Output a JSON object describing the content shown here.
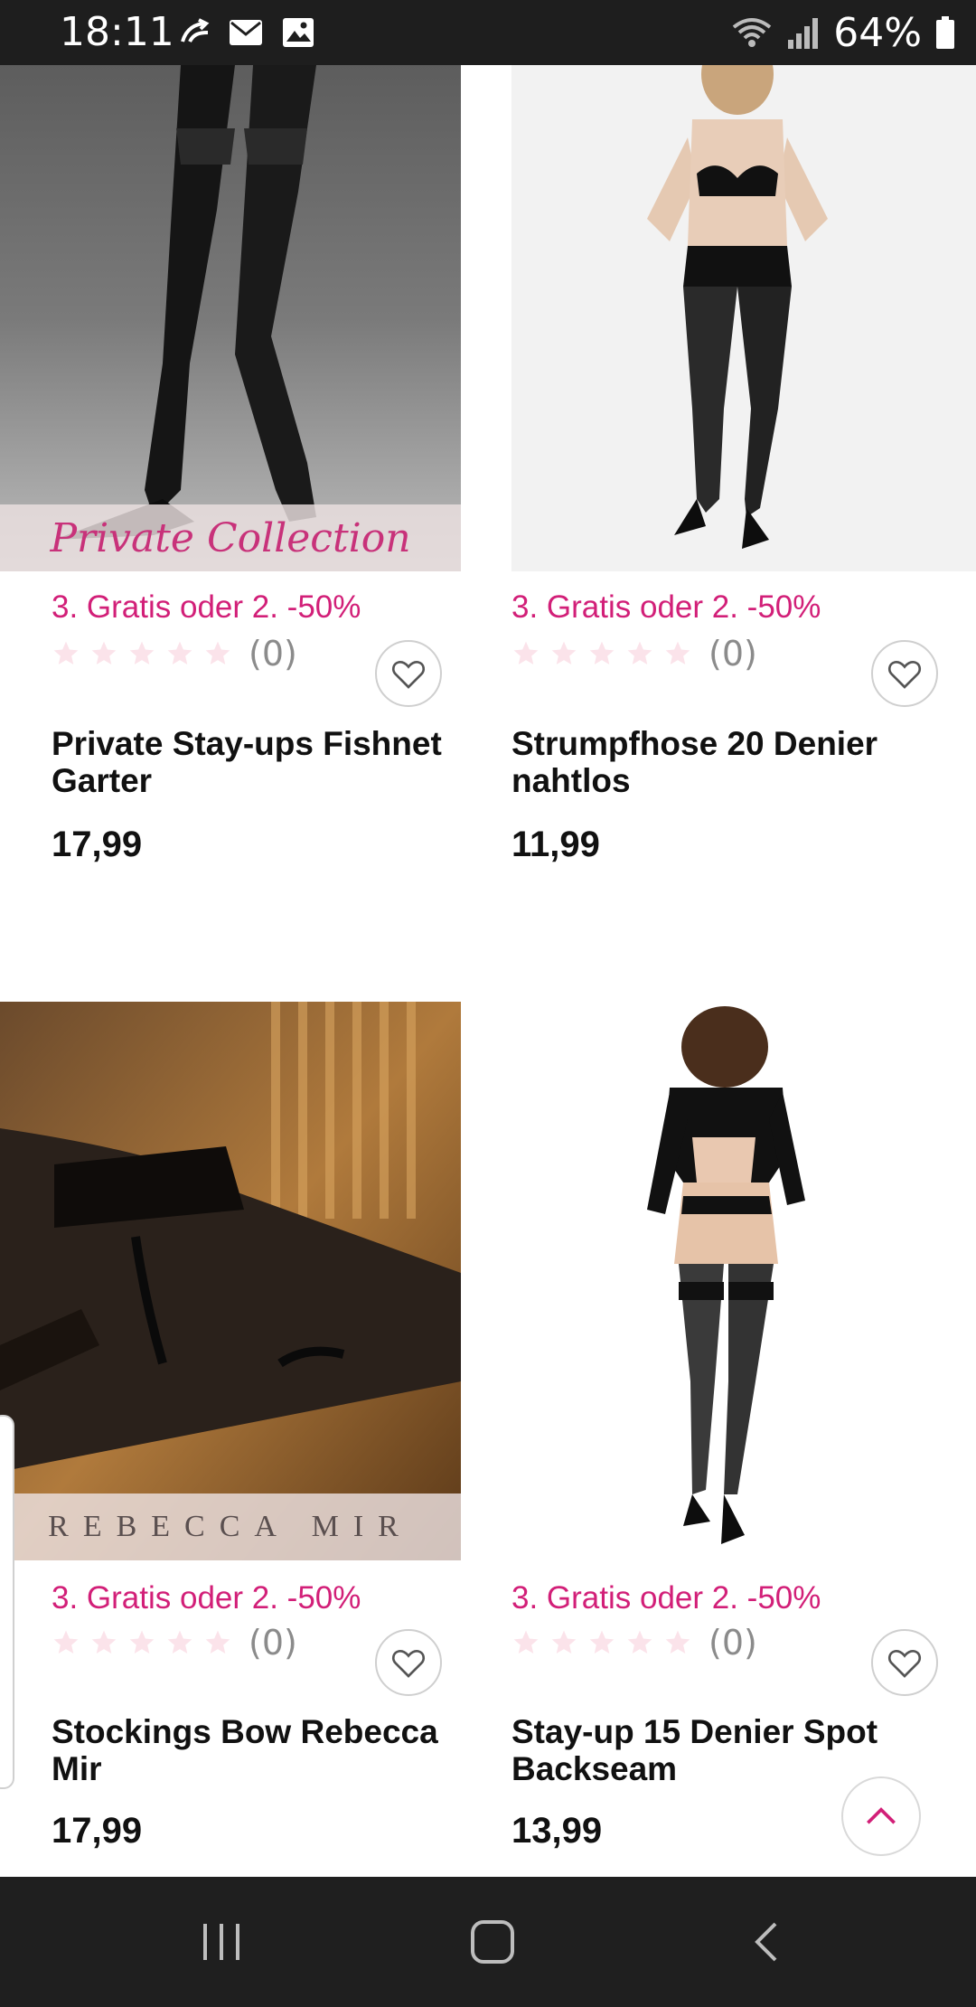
{
  "status_bar": {
    "time": "18:11",
    "battery_percent": "64%",
    "icons": [
      "sync-icon",
      "mail-icon",
      "image-icon",
      "wifi-icon",
      "signal-icon",
      "battery-icon"
    ]
  },
  "colors": {
    "accent": "#d21f78",
    "status_bar_bg": "#1e1e1e",
    "nav_bar_bg": "#1f1f1f"
  },
  "products": [
    {
      "promo": "3. Gratis oder 2. -50%",
      "rating_count": "(0)",
      "rating": 0,
      "name": "Private Stay-ups Fishnet Garter",
      "price": "17,99",
      "brand_text": "Private Collection"
    },
    {
      "promo": "3. Gratis oder 2. -50%",
      "rating_count": "(0)",
      "rating": 0,
      "name": "Strumpfhose 20 Denier nahtlos",
      "price": "11,99"
    },
    {
      "promo": "3. Gratis oder 2. -50%",
      "rating_count": "(0)",
      "rating": 0,
      "name": "Stockings Bow Rebecca Mir",
      "price": "17,99",
      "brand_text": "REBECCA MIR"
    },
    {
      "promo": "3. Gratis oder 2. -50%",
      "rating_count": "(0)",
      "rating": 0,
      "name": "Stay-up 15 Denier Spot Backseam",
      "price": "13,99"
    }
  ],
  "nav_bar": {
    "buttons": [
      "recent-apps-icon",
      "home-icon",
      "back-icon"
    ]
  }
}
